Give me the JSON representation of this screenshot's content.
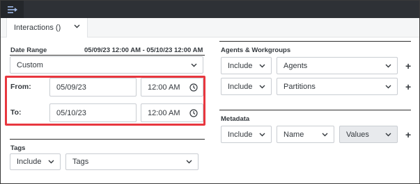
{
  "header": {
    "menu_icon": "expand-menu-icon"
  },
  "tab": {
    "label": "Interactions ()"
  },
  "date_range": {
    "label": "Date Range",
    "value": "05/09/23 12:00 AM - 05/10/23 12:00 AM",
    "preset": "Custom",
    "from_label": "From:",
    "from_date": "05/09/23",
    "from_time": "12:00 AM",
    "to_label": "To:",
    "to_date": "05/10/23",
    "to_time": "12:00 AM"
  },
  "tags": {
    "label": "Tags",
    "mode": "Include",
    "value": "Tags"
  },
  "agents_workgroups": {
    "label": "Agents & Workgroups",
    "rows": [
      {
        "mode": "Include",
        "value": "Agents"
      },
      {
        "mode": "Include",
        "value": "Partitions"
      }
    ],
    "add_label": "+"
  },
  "metadata": {
    "label": "Metadata",
    "mode": "Include",
    "name": "Name",
    "values": "Values",
    "add_label": "+"
  },
  "colors": {
    "highlight": "#e8373f",
    "topbar": "#2e3136"
  }
}
